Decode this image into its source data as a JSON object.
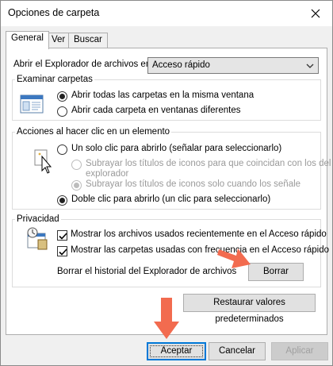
{
  "window": {
    "title": "Opciones de carpeta"
  },
  "tabs": [
    {
      "label": "General",
      "active": true
    },
    {
      "label": "Ver",
      "active": false
    },
    {
      "label": "Buscar",
      "active": false
    }
  ],
  "open_explorer": {
    "label": "Abrir el Explorador de archivos en:",
    "value": "Acceso rápido"
  },
  "browse_folders": {
    "legend": "Examinar carpetas",
    "option1": "Abrir todas las carpetas en la misma ventana",
    "option2": "Abrir cada carpeta en ventanas diferentes",
    "selected": "option1"
  },
  "click_items": {
    "legend": "Acciones al hacer clic en un elemento",
    "single_click": "Un solo clic para abrirlo (señalar para seleccionarlo)",
    "underline_browser_1": "Subrayar los títulos de iconos para que coincidan con los del",
    "underline_browser_2": "explorador",
    "underline_point": "Subrayar los títulos de iconos solo cuando los señale",
    "double_click": "Doble clic para abrirlo (un clic para seleccionarlo)",
    "selected": "double_click"
  },
  "privacy": {
    "legend": "Privacidad",
    "show_recent_files": "Mostrar los archivos usados recientemente en el Acceso rápido",
    "show_frequent_folders": "Mostrar las carpetas usadas con frecuencia en el Acceso rápido",
    "clear_history_label": "Borrar el historial del Explorador de archivos",
    "clear_button": "Borrar",
    "recent_checked": true,
    "frequent_checked": true
  },
  "restore_defaults_button": "Restaurar valores predeterminados",
  "footer": {
    "ok": "Aceptar",
    "cancel": "Cancelar",
    "apply": "Aplicar"
  },
  "colors": {
    "annotation_arrow": "#f26b4f",
    "default_button_border": "#0078d7"
  },
  "icons": [
    "close-icon",
    "dropdown-arrow-icon",
    "folder-window-icon",
    "pointer-click-icon",
    "privacy-icon",
    "annotation-arrow-icon"
  ]
}
